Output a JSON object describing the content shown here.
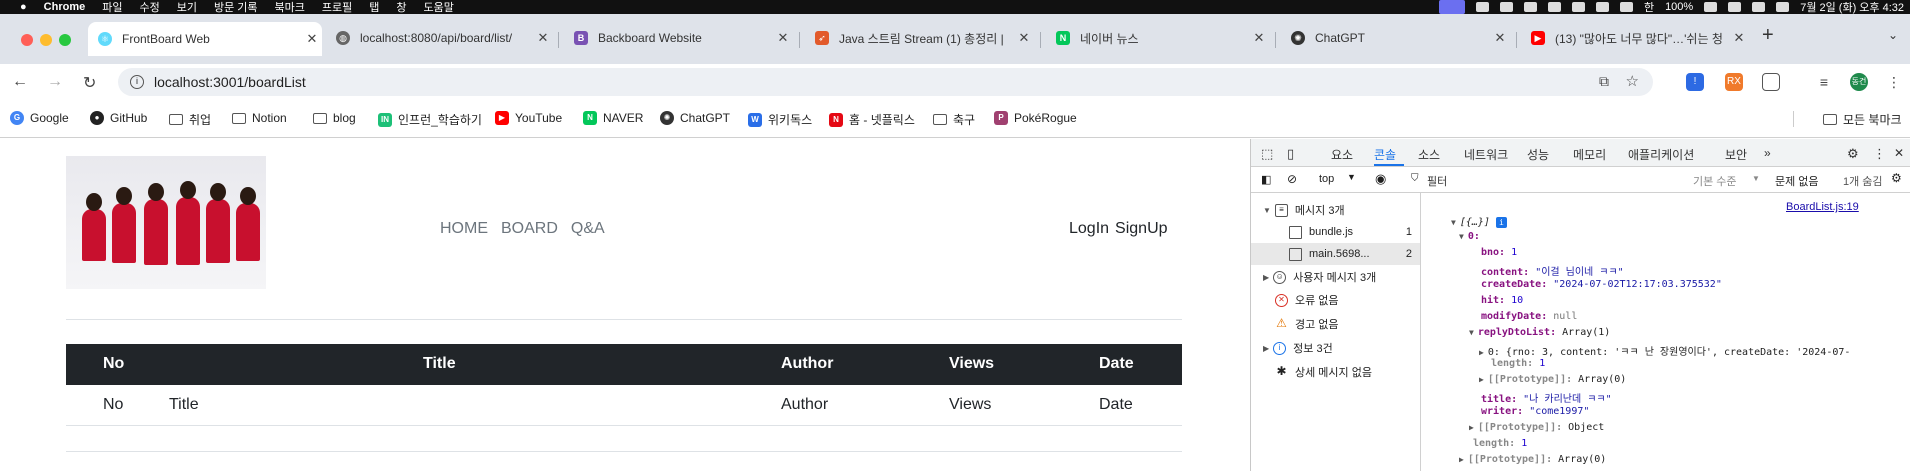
{
  "menubar": {
    "app_name": "Chrome",
    "menus": [
      "파일",
      "수정",
      "보기",
      "방문 기록",
      "북마크",
      "프로필",
      "탭",
      "창",
      "도움말"
    ],
    "battery": "100%",
    "ime": "한",
    "datetime": "7월 2일 (화) 오후 4:32"
  },
  "tabs": [
    {
      "title": "FrontBoard Web",
      "favicon": "react-icon",
      "color": "#61dafb",
      "active": true
    },
    {
      "title": "localhost:8080/api/board/list/",
      "favicon": "globe-icon",
      "color": "#666666",
      "active": false
    },
    {
      "title": "Backboard Website",
      "favicon": "bootstrap-icon",
      "color": "#7952b3",
      "active": false
    },
    {
      "title": "Java 스트림 Stream (1) 총정리 |",
      "favicon": "rocket-icon",
      "color": "#e25a2b",
      "active": false
    },
    {
      "title": "네이버 뉴스",
      "favicon": "naver-icon",
      "color": "#03c75a",
      "active": false
    },
    {
      "title": "ChatGPT",
      "favicon": "openai-icon",
      "color": "#333333",
      "active": false
    },
    {
      "title": "(13) \"많아도 너무 많다\"…'쉬는 청",
      "favicon": "youtube-icon",
      "color": "#ff0000",
      "active": false
    }
  ],
  "toolbar": {
    "url": "localhost:3001/boardList",
    "profile_label": "동건"
  },
  "bookmarks": [
    {
      "label": "Google",
      "icon": "google-icon",
      "color": "#4285f4"
    },
    {
      "label": "GitHub",
      "icon": "github-icon",
      "color": "#222222"
    },
    {
      "label": "취업",
      "icon": "folder-icon",
      "color": ""
    },
    {
      "label": "Notion",
      "icon": "folder-icon",
      "color": ""
    },
    {
      "label": "blog",
      "icon": "folder-icon",
      "color": ""
    },
    {
      "label": "인프런_학습하기",
      "icon": "inflearn-icon",
      "color": "#1dc078"
    },
    {
      "label": "YouTube",
      "icon": "youtube-icon",
      "color": "#ff0000"
    },
    {
      "label": "NAVER",
      "icon": "naver-icon",
      "color": "#03c75a"
    },
    {
      "label": "ChatGPT",
      "icon": "openai-icon",
      "color": "#333333"
    },
    {
      "label": "위키독스",
      "icon": "wikidocs-icon",
      "color": "#2a6ee8"
    },
    {
      "label": "홈 - 넷플릭스",
      "icon": "netflix-icon",
      "color": "#e50914"
    },
    {
      "label": "축구",
      "icon": "folder-icon",
      "color": ""
    },
    {
      "label": "PokéRogue",
      "icon": "pokerogue-icon",
      "color": "#a04070"
    }
  ],
  "all_bookmarks_label": "모든 북마크",
  "site": {
    "nav": [
      "HOME",
      "BOARD",
      "Q&A"
    ],
    "auth": [
      "LogIn",
      "SignUp"
    ],
    "table_headers": [
      "No",
      "Title",
      "Author",
      "Views",
      "Date"
    ],
    "table_rows": [
      [
        "No",
        "Title",
        "Author",
        "Views",
        "Date"
      ]
    ]
  },
  "devtools": {
    "tabs": [
      "요소",
      "콘솔",
      "소스",
      "네트워크",
      "성능",
      "메모리",
      "애플리케이션",
      "보안"
    ],
    "active_tab": "콘솔",
    "context": "top",
    "filter_placeholder": "필터",
    "level": "기본 수준",
    "issues": "문제 없음",
    "hidden": "1개 숨김",
    "sidebar": [
      {
        "label": "메시지 3개",
        "count": "",
        "icon": "list-icon"
      },
      {
        "label": "bundle.js",
        "count": "1",
        "icon": "file-icon"
      },
      {
        "label": "main.5698...",
        "count": "2",
        "icon": "file-icon"
      },
      {
        "label": "사용자 메시지 3개",
        "count": "",
        "icon": "user-icon"
      },
      {
        "label": "오류 없음",
        "count": "",
        "icon": "error-icon"
      },
      {
        "label": "경고 없음",
        "count": "",
        "icon": "warning-icon"
      },
      {
        "label": "정보 3건",
        "count": "",
        "icon": "info-icon"
      },
      {
        "label": "상세 메시지 없음",
        "count": "",
        "icon": "bug-icon"
      }
    ],
    "source_link": "BoardList.js:19",
    "log": {
      "array_preview": "[{…}]",
      "index0": "0:",
      "bno_key": "bno:",
      "bno": "1",
      "content_key": "content:",
      "content": "\"이걸 님이네 ㅋㅋ\"",
      "createDate_key": "createDate:",
      "createDate": "\"2024-07-02T12:17:03.375532\"",
      "hit_key": "hit:",
      "hit": "10",
      "modifyDate_key": "modifyDate:",
      "modifyDate": "null",
      "replyDtoList_key": "replyDtoList:",
      "replyDtoList": "Array(1)",
      "reply0": "0: {rno: 3, content: 'ㅋㅋ 난 장원영이다', createDate: '2024-07-",
      "length_key": "length:",
      "length1": "1",
      "proto_key": "[[Prototype]]:",
      "proto_array0": "Array(0)",
      "title_key": "title:",
      "title": "\"나 카리난데 ㅋㅋ\"",
      "writer_key": "writer:",
      "writer": "\"come1997\"",
      "proto_object": "Object",
      "proto_array": "Array(0)"
    }
  }
}
